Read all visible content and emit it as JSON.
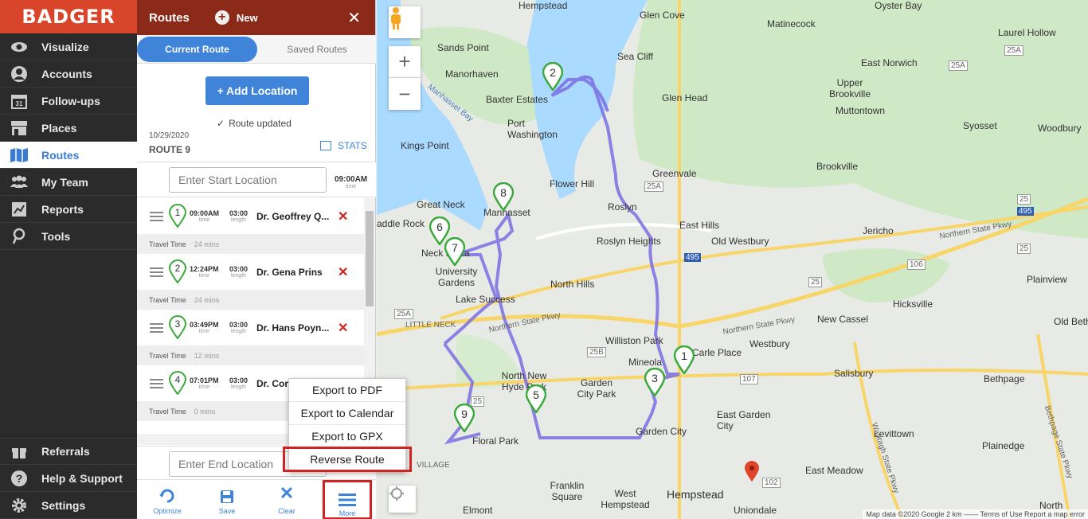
{
  "nav": {
    "logo": "BADGER",
    "items": [
      {
        "label": "Visualize",
        "icon": "eye-icon"
      },
      {
        "label": "Accounts",
        "icon": "person-icon"
      },
      {
        "label": "Follow-ups",
        "icon": "calendar-icon"
      },
      {
        "label": "Places",
        "icon": "store-icon"
      },
      {
        "label": "Routes",
        "icon": "map-icon"
      },
      {
        "label": "My Team",
        "icon": "team-icon"
      },
      {
        "label": "Reports",
        "icon": "report-icon"
      },
      {
        "label": "Tools",
        "icon": "tools-icon"
      }
    ],
    "calendar_day": "31",
    "bottom": [
      {
        "label": "Referrals",
        "icon": "gift-icon"
      },
      {
        "label": "Help & Support",
        "icon": "help-icon"
      },
      {
        "label": "Settings",
        "icon": "gear-icon"
      }
    ]
  },
  "panel": {
    "title": "Routes",
    "new_label": "New",
    "close": "✕",
    "tab_current": "Current Route",
    "tab_saved": "Saved Routes",
    "add_location": "+ Add Location",
    "route_updated": "Route updated",
    "date": "10/29/2020",
    "route_name": "ROUTE 9",
    "stats": "STATS",
    "start_placeholder": "Enter Start Location",
    "start_time": "09:00AM",
    "start_time_label": "time",
    "end_placeholder": "Enter End Location",
    "stops": [
      {
        "num": "1",
        "time": "09:00AM",
        "length": "03:00",
        "name": "Dr. Geoffrey Q...",
        "travel": "24 mins"
      },
      {
        "num": "2",
        "time": "12:24PM",
        "length": "03:00",
        "name": "Dr. Gena Prins",
        "travel": "24 mins"
      },
      {
        "num": "3",
        "time": "03:49PM",
        "length": "03:00",
        "name": "Dr. Hans Poyn...",
        "travel": "12 mins"
      },
      {
        "num": "4",
        "time": "07:01PM",
        "length": "03:00",
        "name": "Dr. Cor",
        "travel": "0 mins"
      }
    ],
    "time_label": "time",
    "length_label": "length",
    "travel_label": "Travel Time",
    "bottom": {
      "optimize": "Optimize",
      "save": "Save",
      "clear": "Clear",
      "more": "More"
    }
  },
  "menu": {
    "items": [
      "Export to PDF",
      "Export to Calendar",
      "Export to GPX",
      "Reverse Route"
    ]
  },
  "map": {
    "labels": {
      "glen_cove": "Glen Cove",
      "matinecock": "Matinecock",
      "sea_cliff": "Sea Cliff",
      "oyster_bay": "Oyster Bay",
      "laurel_hollow": "Laurel Hollow",
      "east_norwich": "East Norwich",
      "sands_point": "Sands Point",
      "manorhaven": "Manorhaven",
      "baxter_estates": "Baxter Estates",
      "hempstead_top": "Hempstead",
      "port_washington": "Port Washington",
      "glen_head": "Glen Head",
      "upper_brookville": "Upper Brookville",
      "muttontown": "Muttontown",
      "syosset": "Syosset",
      "woodbury": "Woodbury",
      "kings_point": "Kings Point",
      "manhasset_bay": "Manhasset Bay",
      "greenvale": "Greenvale",
      "flower_hill": "Flower Hill",
      "brookville": "Brookville",
      "great_neck": "Great Neck",
      "manhasset": "Manhasset",
      "roslyn": "Roslyn",
      "east_hills": "East Hills",
      "jericho": "Jericho",
      "saddle_rock": "addle Rock",
      "neck_plaza": "Neck Plaza",
      "roslyn_heights": "Roslyn Heights",
      "old_westbury": "Old Westbury",
      "northern_state_right": "Northern State Pkwy",
      "university_gardens": "University Gardens",
      "north_hills": "North Hills",
      "plainview": "Plainview",
      "lake_success": "Lake Success",
      "little_neck": "LITTLE NECK",
      "hicksville": "Hicksville",
      "northern_state_mid": "Northern State Pkwy",
      "northern_state_left": "Northern State Pkwy",
      "new_cassel": "New Cassel",
      "old_beth": "Old Beth",
      "williston_park": "Williston Park",
      "carle_place": "Carle Place",
      "westbury": "Westbury",
      "mineola": "Mineola",
      "north_new_hyde": "North New Hyde Park",
      "new_hyde": "New Hyde Park",
      "garden_city_park": "Garden City Park",
      "salisbury": "Salisbury",
      "bethpage": "Bethpage",
      "east_garden_city": "East Garden City",
      "garden_city": "Garden City",
      "floral_park": "Floral Park",
      "levittown": "Levittown",
      "plainedge": "Plainedge",
      "village": "VILLAGE",
      "franklin_square": "Franklin Square",
      "west_hempstead": "West Hempstead",
      "hempstead": "Hempstead",
      "uniondale": "Uniondale",
      "east_meadow": "East Meadow",
      "elmont": "Elmont",
      "north": "North",
      "wantagh": "Wantagh State Pkwy",
      "bethpage_pkwy": "Bethpage State Pkwy",
      "route_25a_a": "25A",
      "route_25a_b": "25A",
      "route_25a_c": "25A",
      "route_25a_d": "25A",
      "route_25": "25",
      "route_25b": "25B",
      "route_25_b": "25",
      "route_25_c": "25",
      "route_25_d": "25",
      "route_25_e": "25",
      "route_107": "107",
      "route_106": "106",
      "route_102": "102",
      "i495": "495",
      "i495b": "495"
    },
    "markers": [
      {
        "num": "1"
      },
      {
        "num": "2"
      },
      {
        "num": "3"
      },
      {
        "num": "5"
      },
      {
        "num": "6"
      },
      {
        "num": "7"
      },
      {
        "num": "8"
      },
      {
        "num": "9"
      }
    ],
    "attribution": "Map data ©2020 Google   2 km ——   Terms of Use   Report a map error",
    "zoom_in": "+",
    "zoom_out": "−"
  }
}
